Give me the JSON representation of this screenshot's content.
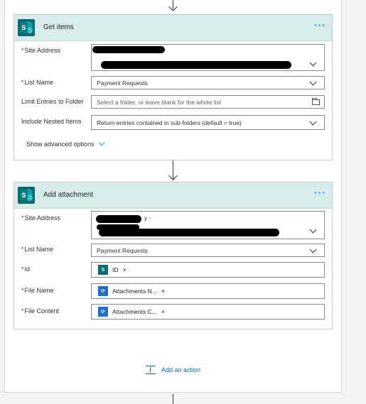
{
  "colors": {
    "accent": "#036c70",
    "link": "#0b6a9e",
    "dots": "#2b88d8",
    "required": "#a4262c",
    "header_bg": "#d9ecec"
  },
  "get_items": {
    "title": "Get items",
    "more_label": "···",
    "site_address": {
      "label": "Site Address",
      "required_mark": "*"
    },
    "list_name": {
      "label": "List Name",
      "required_mark": "*",
      "value": "Payment Requests"
    },
    "limit_folder": {
      "label": "Limit Entries to Folder",
      "placeholder": "Select a folder, or leave blank for the whole list"
    },
    "nested": {
      "label": "Include Nested Items",
      "value": "Return entries contained in sub-folders (default = true)"
    },
    "advanced": "Show advanced options"
  },
  "add_attachment": {
    "title": "Add attachment",
    "more_label": "···",
    "site_address": {
      "label": "Site Address",
      "required_mark": "*",
      "visible_fragment": "y -"
    },
    "list_name": {
      "label": "List Name",
      "required_mark": "*",
      "value": "Payment Requests"
    },
    "id": {
      "label": "Id",
      "required_mark": "*",
      "token": "ID",
      "token_icon": "sharepoint-icon"
    },
    "file_name": {
      "label": "File Name",
      "required_mark": "*",
      "token": "Attachments N...",
      "token_icon": "loop-icon"
    },
    "file_content": {
      "label": "File Content",
      "required_mark": "*",
      "token": "Attachments C...",
      "token_icon": "loop-icon"
    }
  },
  "token_remove": "×",
  "add_action": "Add an action"
}
